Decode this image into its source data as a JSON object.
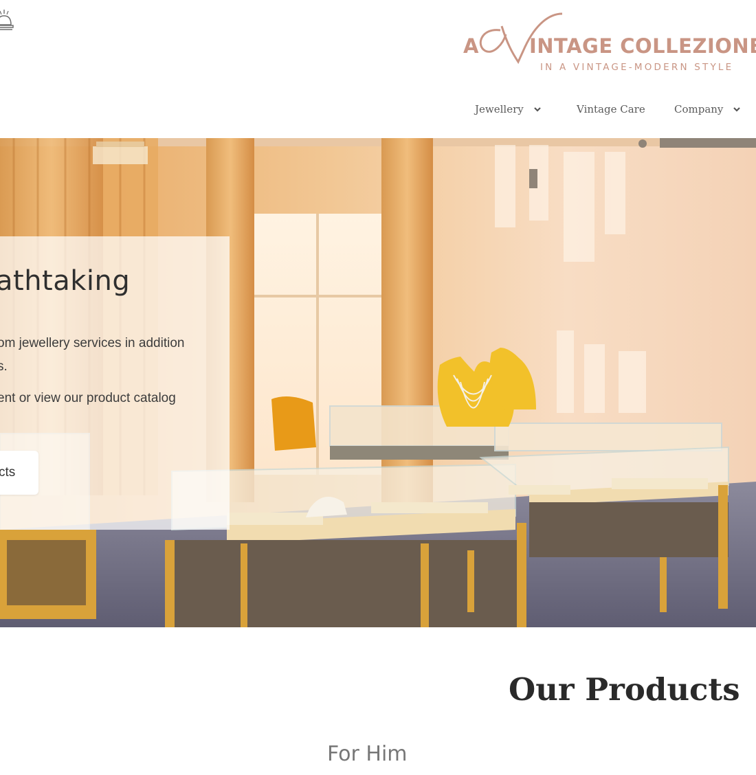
{
  "brand": {
    "logo_a": "A",
    "logo_name": "INTAGE COLLEZIONE",
    "logo_tagline": "IN A VINTAGE-MODERN STYLE",
    "color": "#c99584"
  },
  "header": {
    "bell_icon": "service-bell-icon"
  },
  "nav": {
    "items": [
      {
        "label": "Jewellery",
        "has_dropdown": true
      },
      {
        "label": "Vintage Care",
        "has_dropdown": false
      },
      {
        "label": "Company",
        "has_dropdown": true
      }
    ]
  },
  "hero": {
    "title": "athtaking",
    "line1": "om jewellery services in addition",
    "line2": "s.",
    "line3": "ent or view our product catalog",
    "button_label": "cts"
  },
  "products": {
    "title": "Our Products",
    "subtitle": "For Him"
  }
}
